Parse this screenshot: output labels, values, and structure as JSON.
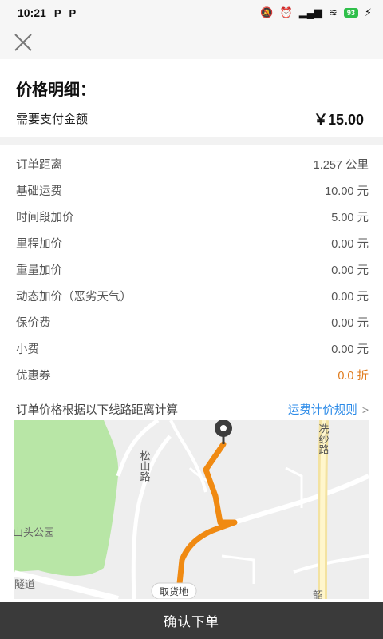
{
  "status_bar": {
    "time": "10:21",
    "app_icons": [
      "P",
      "P"
    ],
    "battery": "93"
  },
  "summary": {
    "title": "价格明细：",
    "pay_label": "需要支付金额",
    "pay_amount": "￥15.00"
  },
  "details": [
    {
      "label": "订单距离",
      "value": "1.257 公里"
    },
    {
      "label": "基础运费",
      "value": "10.00 元"
    },
    {
      "label": "时间段加价",
      "value": "5.00 元"
    },
    {
      "label": "里程加价",
      "value": "0.00 元"
    },
    {
      "label": "重量加价",
      "value": "0.00 元"
    },
    {
      "label": "动态加价（恶劣天气）",
      "value": "0.00 元"
    },
    {
      "label": "保价费",
      "value": "0.00 元"
    },
    {
      "label": "小费",
      "value": "0.00 元"
    },
    {
      "label": "优惠券",
      "value": "0.0 折"
    }
  ],
  "route_note": {
    "text": "订单价格根据以下线路距离计算",
    "rules_link": "运费计价规则"
  },
  "map": {
    "road_labels": {
      "songshan": "松山路",
      "xiansha": "冼纱路",
      "park": "山头公园",
      "tunnel": "隧道",
      "bottom_cut": "韶"
    },
    "pickup_label": "取货地",
    "route_color": "#f08a12",
    "park_color": "#b7e6a8"
  },
  "confirm_button": "确认下单",
  "icons": {
    "close": "close-icon",
    "chevron": "chevron-right-icon",
    "pin": "location-pin-icon"
  }
}
